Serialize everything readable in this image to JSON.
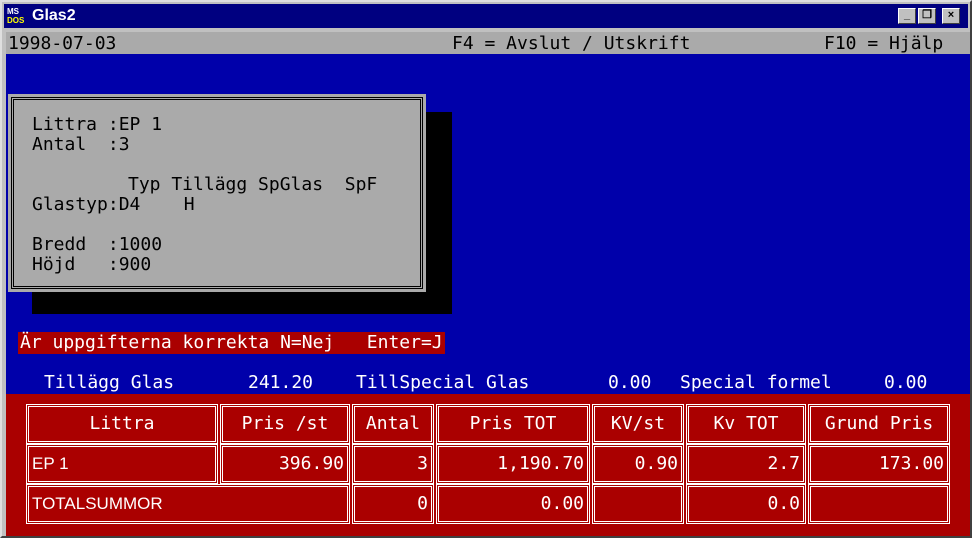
{
  "window": {
    "title": "Glas2",
    "icon_text": "MS DOS"
  },
  "statusbar": {
    "date": "1998-07-03",
    "f4": "F4 = Avslut / Utskrift",
    "f10": "F10 = Hjälp"
  },
  "dialog": {
    "littra": "Littra :EP 1",
    "antal": "Antal  :3",
    "col_header": "Typ Tillägg SpGlas  SpF",
    "glastyp": "Glastyp:D4    H",
    "bredd": "Bredd  :1000",
    "hojd": "Höjd   :900"
  },
  "prompt": "Är uppgifterna korrekta N=Nej   Enter=J",
  "info": {
    "tillagg_label": "Tillägg Glas",
    "tillagg_value": "241.20",
    "special_label": "TillSpecial Glas",
    "special_value": "0.00",
    "formel_label": "Special formel",
    "formel_value": "0.00"
  },
  "table": {
    "headers": [
      "Littra",
      "Pris /st",
      "Antal",
      "Pris TOT",
      "KV/st",
      "Kv TOT",
      "Grund Pris"
    ],
    "rows": [
      [
        "EP 1",
        "396.90",
        "3",
        "1,190.70",
        "0.90",
        "2.7",
        "173.00"
      ],
      [
        "TOTALSUMMOR",
        "",
        "0",
        "0.00",
        "",
        "0.0",
        ""
      ]
    ]
  }
}
